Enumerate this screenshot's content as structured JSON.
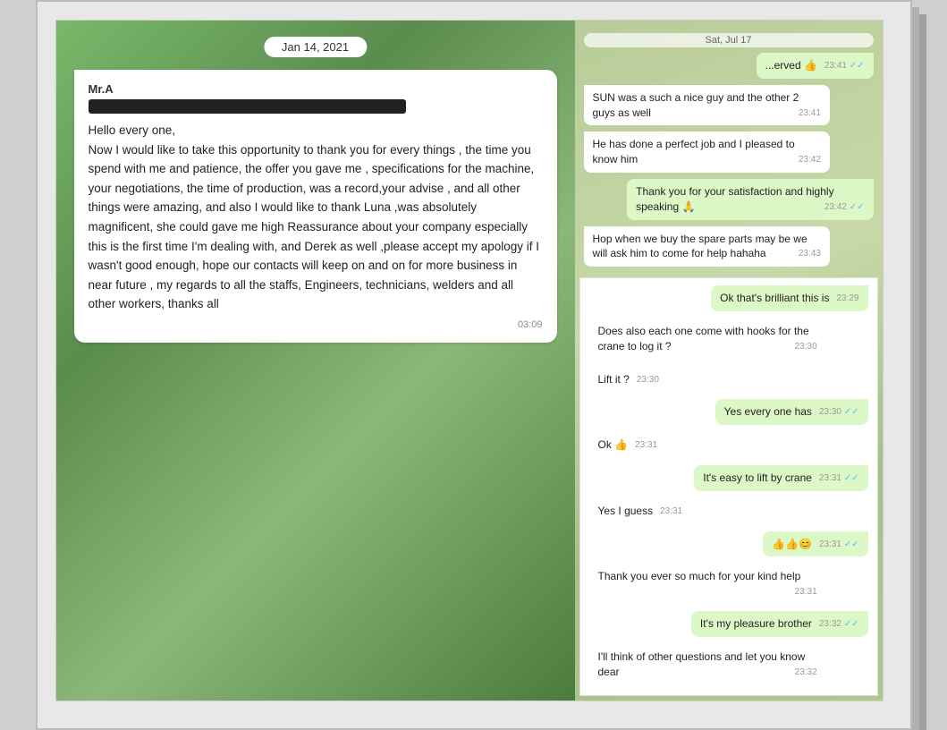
{
  "left": {
    "date": "Jan 14, 2021",
    "sender": "Mr.A",
    "redacted": true,
    "message": "Hello every one,\nNow I would like to take this opportunity to thank you  for every things , the time you spend with me and patience, the offer you gave me , specifications for the machine, your negotiations, the time of production, was a record,your advise , and all other things were amazing,  and also I would like to thank Luna ,was absolutely magnificent,  she could gave me high Reassurance about your company especially this is the first time I'm dealing with, and Derek as well ,please accept my apology if I wasn't good enough,  hope our contacts will keep on and on for more business in near future  , my regards to all the staffs, Engineers, technicians, welders and all other workers,  thanks all",
    "time": "03:09"
  },
  "right_top": {
    "date_badge": "Sat, Jul 17",
    "messages": [
      {
        "type": "sent",
        "text": "...erved 👍",
        "time": "23:41",
        "checks": true
      },
      {
        "type": "received",
        "text": "SUN was a such a nice guy and the other 2 guys as well",
        "time": "23:41"
      },
      {
        "type": "received",
        "text": "He has done a perfect job  and I pleased to know him",
        "time": "23:42"
      },
      {
        "type": "sent",
        "text": "Thank you for your satisfaction and highly speaking 🙏",
        "time": "23:42",
        "checks": true
      },
      {
        "type": "received",
        "text": "Hop when we buy the spare parts  may be we will ask him to come for help hahaha",
        "time": "23:43"
      }
    ]
  },
  "right_bottom": {
    "messages": [
      {
        "type": "sent",
        "text": "Ok that's brilliant this is",
        "time": "23:29"
      },
      {
        "type": "received",
        "text": "Does also each one come with hooks for the crane to log it ?",
        "time": "23:30"
      },
      {
        "type": "received",
        "text": "Lift it ?",
        "time": "23:30"
      },
      {
        "type": "sent",
        "text": "Yes every one has",
        "time": "23:30",
        "checks": true
      },
      {
        "type": "received",
        "text": "Ok 👍",
        "time": "23:31"
      },
      {
        "type": "sent",
        "text": "It's easy to lift by crane",
        "time": "23:31",
        "checks": true
      },
      {
        "type": "received",
        "text": "Yes I guess",
        "time": "23:31"
      },
      {
        "type": "sent",
        "text": "👍👍😊",
        "time": "23:31",
        "checks": true
      },
      {
        "type": "received",
        "text": "Thank you ever so much for your kind help",
        "time": "23:31"
      },
      {
        "type": "sent",
        "text": "It's my pleasure brother",
        "time": "23:32",
        "checks": true
      },
      {
        "type": "received",
        "text": "I'll think of other questions and let you know dear",
        "time": "23:32"
      }
    ]
  }
}
